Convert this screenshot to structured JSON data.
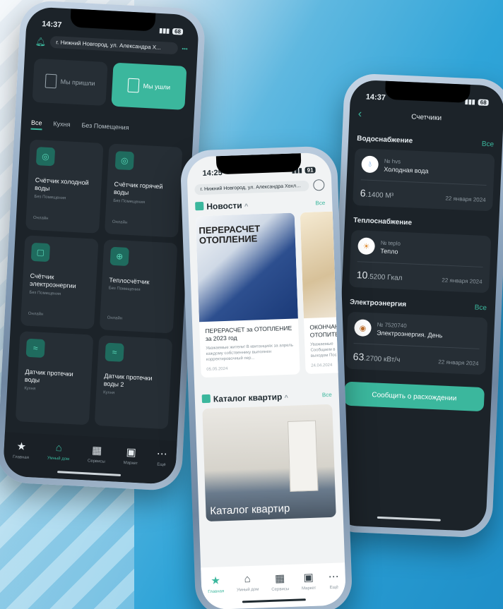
{
  "left_phone": {
    "time": "14:37",
    "battery": "68",
    "address": "г. Нижний Новгород, ул. Александра Х...",
    "arrive_label": "Мы пришли",
    "leave_label": "Мы ушли",
    "tabs": [
      "Все",
      "Кухня",
      "Без Помещения"
    ],
    "devices": [
      {
        "name": "Счётчик холодной воды",
        "room": "Без Помещения",
        "status": "Онлайн",
        "icon": "meter-icon"
      },
      {
        "name": "Счётчик горячей воды",
        "room": "Без Помещения",
        "status": "Онлайн",
        "icon": "meter-icon"
      },
      {
        "name": "Счётчик электроэнергии",
        "room": "Без Помещения",
        "status": "Онлайн",
        "icon": "electric-meter-icon"
      },
      {
        "name": "Теплосчётчик",
        "room": "Без Помещения",
        "status": "Онлайн",
        "icon": "heat-meter-icon"
      },
      {
        "name": "Датчик протечки воды",
        "room": "Кухня",
        "status": "",
        "icon": "leak-sensor-icon"
      },
      {
        "name": "Датчик протечки воды 2",
        "room": "Кухня",
        "status": "",
        "icon": "leak-sensor-icon"
      }
    ],
    "nav": [
      "Главная",
      "Умный дом",
      "Сервисы",
      "Маркет",
      "Ещё"
    ]
  },
  "middle_phone": {
    "time": "14:25",
    "battery": "91",
    "address": "г. Нижний Новгород, ул. Александра Хохлова,...",
    "news_title": "Новости",
    "all_label": "Все",
    "news": [
      {
        "image_text": "ПЕРЕРАСЧЕТ ОТОПЛЕНИЕ",
        "title": "ПЕРЕРАСЧЕТ за ОТОПЛЕНИЕ за 2023 год",
        "text": "Уважаемые жители! В квитанциях за апрель каждому собственнику выполнен корректировочный пер...",
        "date": "05.05.2024"
      },
      {
        "image_text": "",
        "title": "ОКОНЧАН ОТОПИТЕ",
        "text": "Уважаемые Сообщаем в выходом Пос",
        "date": "24.04.2024"
      }
    ],
    "catalog_title": "Каталог квартир",
    "catalog_caption": "Каталог квартир",
    "nav": [
      "Главная",
      "Умный дом",
      "Сервисы",
      "Маркет",
      "Ещё"
    ]
  },
  "right_phone": {
    "time": "14:37",
    "battery": "68",
    "title": "Счетчики",
    "all_label": "Все",
    "report_button": "Сообщить о расхождении",
    "groups": [
      {
        "title": "Водоснабжение",
        "show_all": true,
        "meter_no": "№ hvs",
        "meter_name": "Холодная вода",
        "value_int": "6",
        "value_frac": ".1400 М³",
        "date": "22 января 2024",
        "icon": "water-drop-icon"
      },
      {
        "title": "Теплоснабжение",
        "show_all": false,
        "meter_no": "№ teplo",
        "meter_name": "Тепло",
        "value_int": "10",
        "value_frac": ".5200 Гкал",
        "date": "22 января 2024",
        "icon": "sun-icon"
      },
      {
        "title": "Электроэнергия",
        "show_all": true,
        "meter_no": "№ 7520740",
        "meter_name": "Электроэнергия. День",
        "value_int": "63",
        "value_frac": ".2700 кВт/ч",
        "date": "22 января 2024",
        "icon": "electricity-icon"
      }
    ]
  },
  "colors": {
    "accent": "#3bb79d",
    "dark_bg": "#1c2329",
    "card_dark": "#262e35",
    "background_blue": "#2fa4d8"
  }
}
